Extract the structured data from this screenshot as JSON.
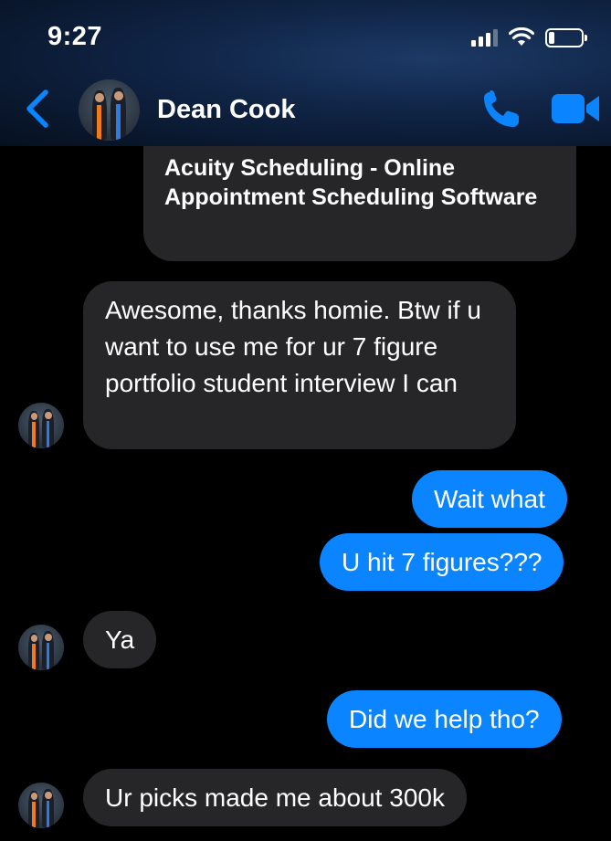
{
  "status_bar": {
    "time": "9:27",
    "icons": [
      "cellular-signal-icon",
      "wifi-icon",
      "battery-icon"
    ]
  },
  "header": {
    "back_icon": "chevron-left-icon",
    "contact_name": "Dean Cook",
    "call_icon": "phone-icon",
    "video_icon": "video-camera-icon",
    "accent_color": "#0a84ff"
  },
  "conversation": {
    "link_preview": {
      "title": "Acuity Scheduling - Online Appointment Scheduling Software"
    },
    "messages": [
      {
        "direction": "incoming",
        "text": "Awesome, thanks homie. Btw if u want to use me for ur 7 figure portfolio student interview I can"
      },
      {
        "direction": "outgoing",
        "text": "Wait what"
      },
      {
        "direction": "outgoing",
        "text": "U hit 7 figures???"
      },
      {
        "direction": "incoming",
        "text": "Ya"
      },
      {
        "direction": "outgoing",
        "text": "Did we help tho?"
      },
      {
        "direction": "incoming",
        "text": "Ur picks made me about 300k"
      }
    ]
  },
  "colors": {
    "incoming_bubble": "#262628",
    "outgoing_bubble": "#0a84ff",
    "background": "#000000"
  }
}
